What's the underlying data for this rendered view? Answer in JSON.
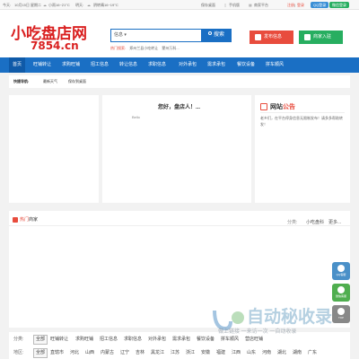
{
  "topbar": {
    "today_label": "今天:",
    "date": "10月15日 星期二",
    "weather_today": "小雨16~21°C",
    "tomorrow_label": "明天:",
    "weather_tomorrow": "阴转晴16~19°C",
    "favorites": "保存桌面",
    "mobile": "手机版",
    "merchant": "商家平台",
    "register": "注册",
    "login": "登录",
    "qq_login": "QQ登录",
    "wx_login": "微信登录"
  },
  "header": {
    "logo_top": "小吃盘店网",
    "logo_bottom": "7854.cn",
    "search_select": "信息 ▾",
    "search_placeholder": "",
    "search_button": "搜索",
    "hot_label": "热门搜索:",
    "hot_keywords": [
      "郑州兰县小吃转让",
      "蒙州万科..."
    ],
    "cta_publish": "发布信息",
    "cta_shop": "商家入驻",
    "colors": {
      "brand_red": "#d91f1f",
      "brand_blue": "#1a6fc4",
      "cta_red": "#e84c3d",
      "cta_green": "#27ae60"
    }
  },
  "nav": {
    "items": [
      {
        "label": "首页"
      },
      {
        "label": "旺铺转让"
      },
      {
        "label": "求购旺铺"
      },
      {
        "label": "招工信息"
      },
      {
        "label": "转让信息"
      },
      {
        "label": "求职信息"
      },
      {
        "label": "对外承包"
      },
      {
        "label": "需求承包"
      },
      {
        "label": "餐饮设备"
      },
      {
        "label": "拼车顺风"
      }
    ]
  },
  "quick_nav": {
    "label": "快捷导航:",
    "items": [
      "最新天气",
      "保存到桌面"
    ]
  },
  "main": {
    "hello_title": "您好，盘店人！...",
    "hello_sub": "Bello",
    "notice_title_a": "网站",
    "notice_title_b": "公告",
    "notice_text": "老乡们，在平台停身信息无限制发布！请多多帮助转发！"
  },
  "shops": {
    "title_a": "热门",
    "title_b": "商家",
    "tag_label": "分类:",
    "tag_item": "小吃盘科",
    "tag_more": "更多..."
  },
  "filter": {
    "row1_label": "分类:",
    "row1": [
      "全部",
      "旺铺转让",
      "求购旺铺",
      "招工信息",
      "求职信息",
      "对外承包",
      "需求承包",
      "餐饮设备",
      "拼车顺风",
      "营店旺铺"
    ],
    "row2_label": "地区:",
    "row2": [
      "全部",
      "直辖市",
      "河北",
      "山西",
      "内蒙古",
      "辽宁",
      "吉林",
      "黑龙江",
      "江苏",
      "浙江",
      "安徽",
      "福建",
      "江西",
      "山东",
      "河南",
      "湖北",
      "湖南",
      "广东"
    ]
  },
  "side": {
    "qq": "QQ客服",
    "wx": "微信客服",
    "top": "TOP"
  },
  "watermark": {
    "text": "自动秘收录",
    "sub": "做上链接 一来访一次 一自动收录"
  }
}
